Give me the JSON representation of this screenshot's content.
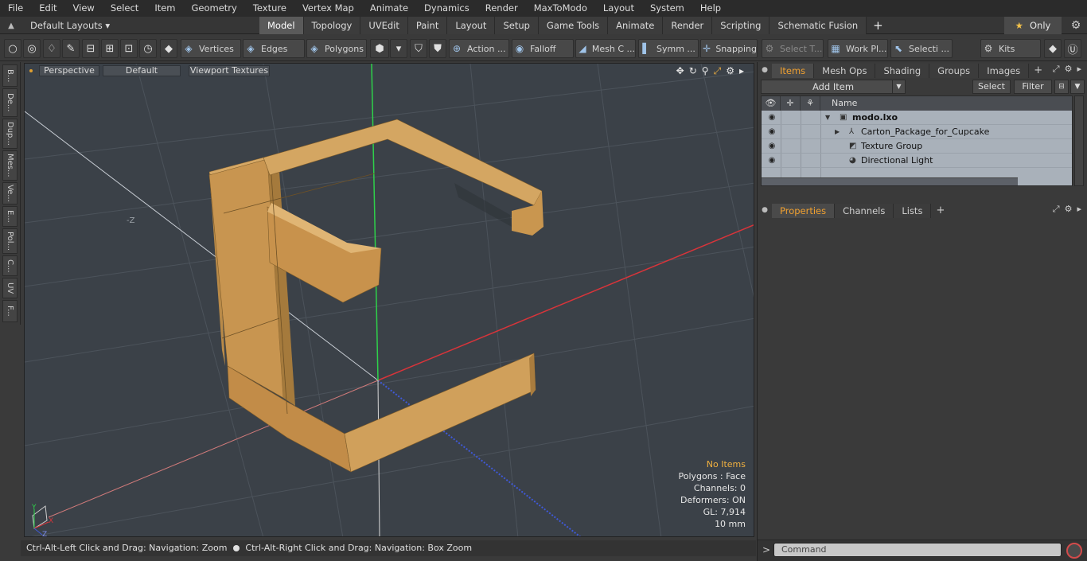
{
  "menubar": [
    "File",
    "Edit",
    "View",
    "Select",
    "Item",
    "Geometry",
    "Texture",
    "Vertex Map",
    "Animate",
    "Dynamics",
    "Render",
    "MaxToModo",
    "Layout",
    "System",
    "Help"
  ],
  "layouts": {
    "label": "Default Layouts ▾",
    "only_label": "Only"
  },
  "tabs": [
    "Model",
    "Topology",
    "UVEdit",
    "Paint",
    "Layout",
    "Setup",
    "Game Tools",
    "Animate",
    "Render",
    "Scripting",
    "Schematic Fusion"
  ],
  "active_tab": "Model",
  "toolbar": {
    "vertices": "Vertices",
    "edges": "Edges",
    "polygons": "Polygons",
    "action": "Action ...",
    "falloff": "Falloff",
    "mesh": "Mesh C ...",
    "symm": "Symm ...",
    "snapping": "Snapping",
    "select_t": "Select T...",
    "work_pl": "Work Pl...",
    "selecti": "Selecti ...",
    "kits": "Kits"
  },
  "left_strip": [
    "B...",
    "De...",
    "Dup...",
    "Mes...",
    "Ve...",
    "E...",
    "Pol...",
    "C...",
    "UV",
    "F..."
  ],
  "viewport": {
    "view": "Perspective",
    "shading": "Default",
    "texture": "Viewport Textures",
    "axis_label": "-Z",
    "info": {
      "items": "No Items",
      "polygons": "Polygons : Face",
      "channels": "Channels: 0",
      "deformers": "Deformers: ON",
      "gl": "GL: 7,914",
      "scale": "10 mm"
    },
    "gizmo": {
      "y": "Y",
      "x": "X",
      "z": "Z"
    }
  },
  "status": {
    "left": "Ctrl-Alt-Left Click and Drag: Navigation: Zoom",
    "right": "Ctrl-Alt-Right Click and Drag: Navigation: Box Zoom"
  },
  "panel_top": {
    "tabs": [
      "Items",
      "Mesh Ops",
      "Shading",
      "Groups",
      "Images"
    ],
    "add_item": "Add Item",
    "select": "Select",
    "filter": "Filter",
    "col_name": "Name",
    "items": [
      {
        "name": "modo.lxo"
      },
      {
        "name": "Carton_Package_for_Cupcake"
      },
      {
        "name": "Texture Group"
      },
      {
        "name": "Directional Light"
      }
    ]
  },
  "panel_bottom": {
    "tabs": [
      "Properties",
      "Channels",
      "Lists"
    ]
  },
  "command": {
    "placeholder": "Command"
  },
  "colors": {
    "accent": "#f0a030",
    "viewport_bg": "#3b4148",
    "model": "#c8964e"
  }
}
